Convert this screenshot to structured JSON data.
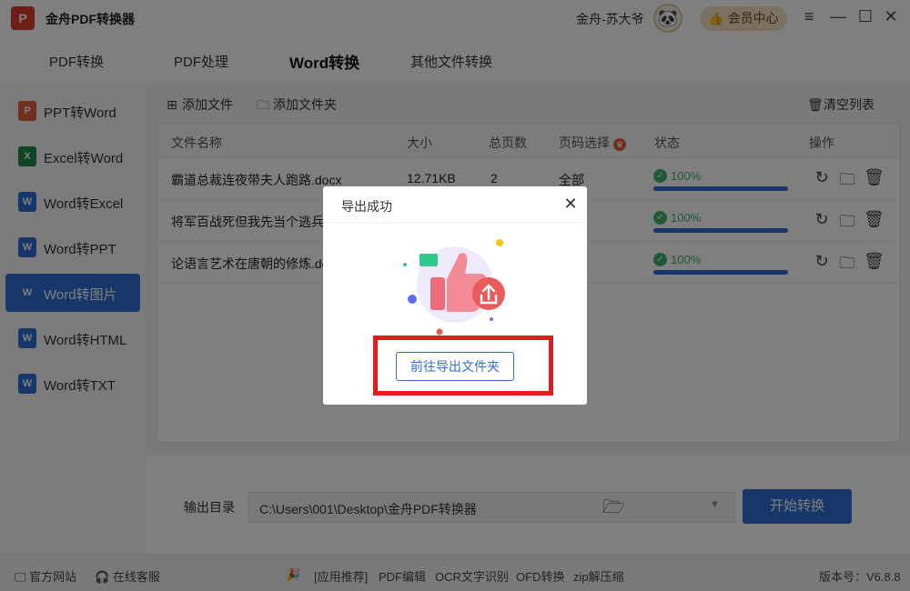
{
  "app": {
    "logo_text": "P",
    "title": "金舟PDF转换器",
    "user_name": "金舟-苏大爷",
    "vip_label": "会员中心",
    "window_controls": [
      "≡",
      "—",
      "☐",
      "✕"
    ]
  },
  "topnav": {
    "tabs": [
      {
        "label": "PDF转换"
      },
      {
        "label": "PDF处理"
      },
      {
        "label": "Word转换"
      },
      {
        "label": "其他文件转换"
      }
    ]
  },
  "sidebar": {
    "items": [
      {
        "label": "PPT转Word",
        "icon": "ppt-icon",
        "icon_text": "P",
        "color": "#e0603a"
      },
      {
        "label": "Excel转Word",
        "icon": "excel-icon",
        "icon_text": "X",
        "color": "#1f8a4c"
      },
      {
        "label": "Word转Excel",
        "icon": "word-icon",
        "icon_text": "W",
        "color": "#2f6fd6"
      },
      {
        "label": "Word转PPT",
        "icon": "word-icon",
        "icon_text": "W",
        "color": "#2f6fd6"
      },
      {
        "label": "Word转图片",
        "icon": "word-icon",
        "icon_text": "W",
        "color": "#2f6fd6"
      },
      {
        "label": "Word转HTML",
        "icon": "word-icon",
        "icon_text": "W",
        "color": "#2f6fd6"
      },
      {
        "label": "Word转TXT",
        "icon": "word-icon",
        "icon_text": "W",
        "color": "#2f6fd6"
      }
    ],
    "active_index": 4
  },
  "toolbar": {
    "add_file": "添加文件",
    "add_folder": "添加文件夹",
    "clear_list": "清空列表"
  },
  "table": {
    "headers": [
      "文件名称",
      "大小",
      "总页数",
      "页码选择",
      "状态",
      "操作"
    ],
    "rows": [
      {
        "name": "霸道总裁连夜带夫人跑路.docx",
        "size": "12.71KB",
        "pages": "2",
        "page_select": "全部",
        "progress": 100,
        "progress_label": "100%"
      },
      {
        "name": "将军百战死但我先当个逃兵.d",
        "size": "",
        "pages": "",
        "page_select": "",
        "progress": 100,
        "progress_label": "100%"
      },
      {
        "name": "论语言艺术在唐朝的修炼.doc",
        "size": "",
        "pages": "",
        "page_select": "",
        "progress": 100,
        "progress_label": "100%"
      }
    ]
  },
  "output": {
    "label": "输出目录",
    "path": "C:\\Users\\001\\Desktop\\金舟PDF转换器",
    "start_label": "开始转换"
  },
  "footer": {
    "website": "官方网站",
    "support": "在线客服",
    "recommend": "[应用推荐]",
    "links": [
      "PDF编辑",
      "OCR文字识别",
      "OFD转换",
      "zip解压缩"
    ],
    "version": "版本号：V6.8.8"
  },
  "modal": {
    "title": "导出成功",
    "button": "前往导出文件夹"
  },
  "colors": {
    "primary": "#2f6fd6",
    "success": "#3cb371",
    "highlight": "#e31b1b"
  }
}
